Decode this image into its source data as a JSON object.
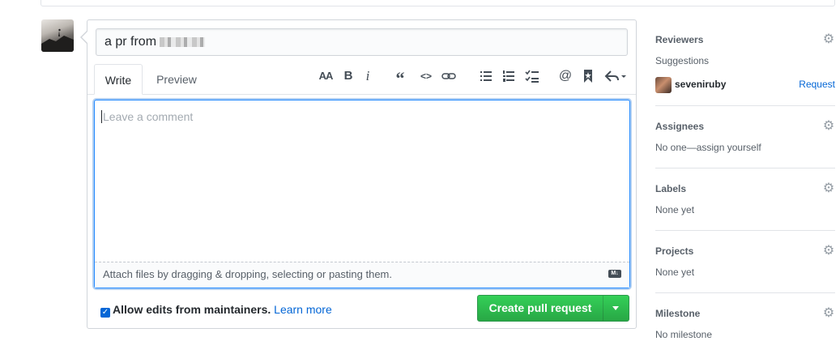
{
  "composer": {
    "title_value": "a pr from",
    "tabs": [
      {
        "label": "Write"
      },
      {
        "label": "Preview"
      }
    ],
    "toolbar_icons": [
      "text-size-icon",
      "bold-icon",
      "italic-icon",
      "quote-icon",
      "code-icon",
      "link-icon",
      "bulleted-list-icon",
      "numbered-list-icon",
      "task-list-icon",
      "mention-icon",
      "saved-reply-icon",
      "reply-icon"
    ],
    "comment_placeholder": "Leave a comment",
    "attach_text": "Attach files by dragging & dropping, selecting or pasting them.",
    "markdown_badge": "M↓",
    "allow_edits_label": "Allow edits from maintainers.",
    "allow_edits_checked": true,
    "learn_more": "Learn more",
    "create_button": "Create pull request",
    "accent_color": "#0366d6",
    "create_color": "#28a745"
  },
  "sidebar": {
    "reviewers": {
      "title": "Reviewers",
      "suggestions_label": "Suggestions",
      "suggested_user": "seveniruby",
      "request_label": "Request"
    },
    "assignees": {
      "title": "Assignees",
      "value": "No one—assign yourself"
    },
    "labels": {
      "title": "Labels",
      "value": "None yet"
    },
    "projects": {
      "title": "Projects",
      "value": "None yet"
    },
    "milestone": {
      "title": "Milestone",
      "value": "No milestone"
    }
  }
}
